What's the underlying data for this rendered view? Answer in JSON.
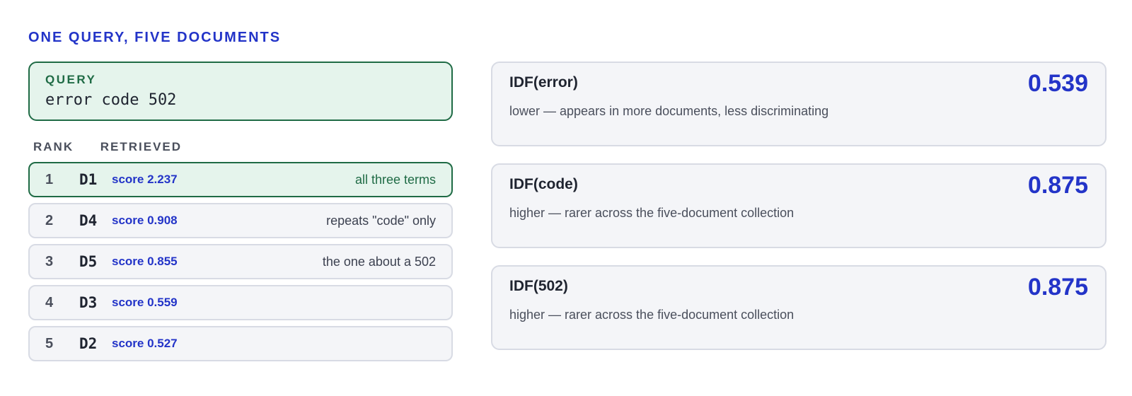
{
  "heading": "ONE QUERY, FIVE DOCUMENTS",
  "query": {
    "label": "QUERY",
    "text": "error code 502"
  },
  "columns": {
    "rank": "RANK",
    "retrieved": "RETRIEVED"
  },
  "results": [
    {
      "rank": "1",
      "doc": "D1",
      "score": "score 2.237",
      "note": "all three terms"
    },
    {
      "rank": "2",
      "doc": "D4",
      "score": "score 0.908",
      "note": "repeats \"code\" only"
    },
    {
      "rank": "3",
      "doc": "D5",
      "score": "score 0.855",
      "note": "the one about a 502"
    },
    {
      "rank": "4",
      "doc": "D3",
      "score": "score 0.559",
      "note": ""
    },
    {
      "rank": "5",
      "doc": "D2",
      "score": "score 0.527",
      "note": ""
    }
  ],
  "idf": [
    {
      "title": "IDF(error)",
      "value": "0.539",
      "desc": "lower — appears in more documents, less discriminating"
    },
    {
      "title": "IDF(code)",
      "value": "0.875",
      "desc": "higher — rarer across the five-document collection"
    },
    {
      "title": "IDF(502)",
      "value": "0.875",
      "desc": "higher — rarer across the five-document collection"
    }
  ],
  "colors": {
    "accent": "#2334c8",
    "match": "#1f6b45",
    "match_bg": "#e5f4ec",
    "card_bg": "#f4f5f8"
  }
}
